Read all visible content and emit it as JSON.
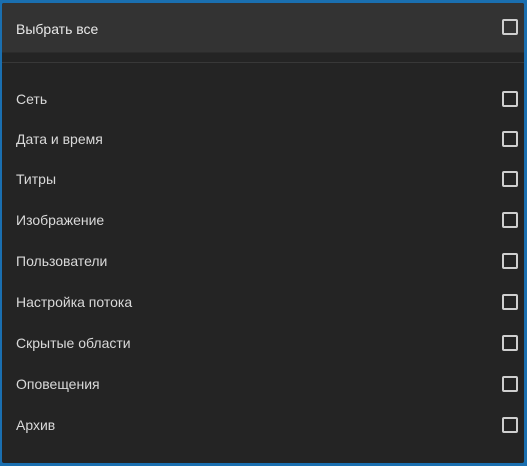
{
  "select_all": {
    "label": "Выбрать все",
    "checked": false
  },
  "items": [
    {
      "label": "Сеть",
      "checked": false
    },
    {
      "label": "Дата и время",
      "checked": false
    },
    {
      "label": "Титры",
      "checked": false
    },
    {
      "label": "Изображение",
      "checked": false
    },
    {
      "label": "Пользователи",
      "checked": false
    },
    {
      "label": "Настройка потока",
      "checked": false
    },
    {
      "label": "Скрытые области",
      "checked": false
    },
    {
      "label": "Оповещения",
      "checked": false
    },
    {
      "label": "Архив",
      "checked": false
    }
  ],
  "colors": {
    "background": "#242424",
    "header_background": "#333333",
    "text": "#d9d9d9",
    "checkbox_border": "#cfcfcf",
    "frame": "#1a6fb0"
  }
}
